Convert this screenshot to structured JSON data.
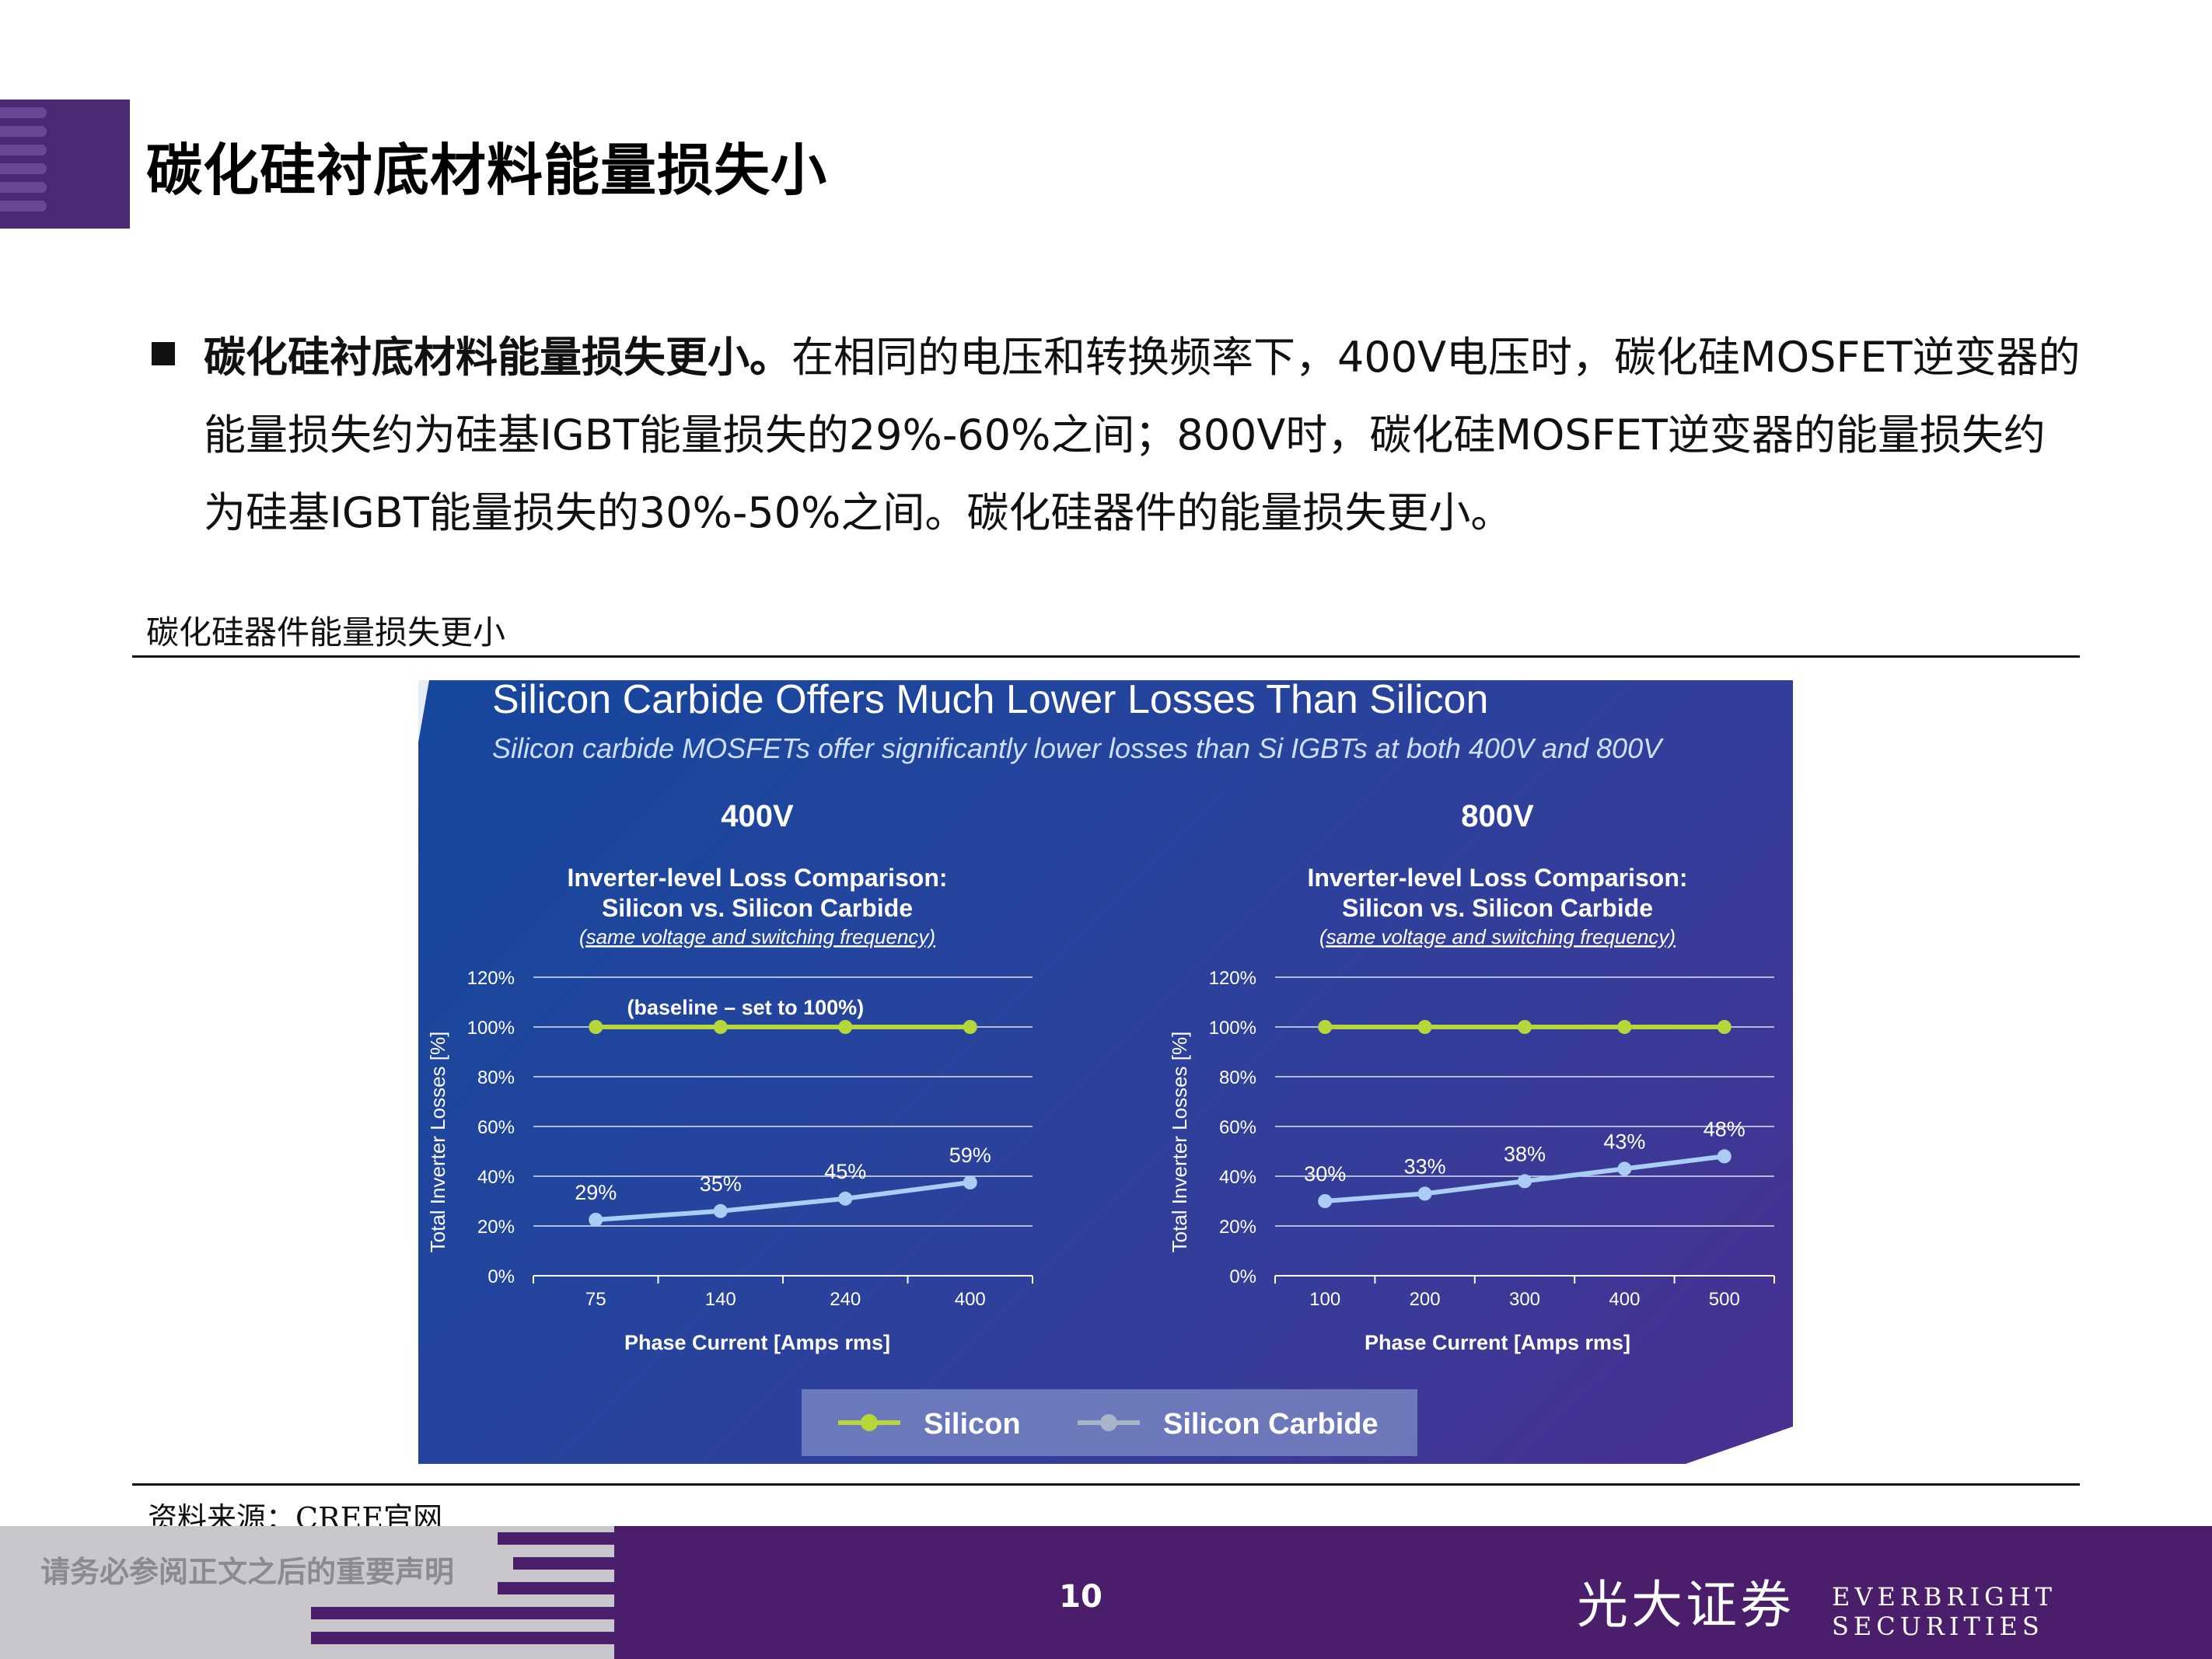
{
  "header": {
    "title": "碳化硅衬底材料能量损失小"
  },
  "bullet": {
    "bold": "碳化硅衬底材料能量损失更小。",
    "body": "在相同的电压和转换频率下，400V电压时，碳化硅MOSFET逆变器的能量损失约为硅基IGBT能量损失的29%-60%之间；800V时，碳化硅MOSFET逆变器的能量损失约为硅基IGBT能量损失的30%-50%之间。碳化硅器件的能量损失更小。"
  },
  "figure_caption": "碳化硅器件能量损失更小",
  "panel": {
    "title": "Silicon Carbide Offers Much Lower Losses Than Silicon",
    "subtitle": "Silicon carbide MOSFETs offer significantly lower losses than Si IGBTs at both 400V and 800V"
  },
  "legend": {
    "silicon": "Silicon",
    "sic": "Silicon Carbide"
  },
  "colors": {
    "silicon": "#b6d63a",
    "sic": "#a9cdf4"
  },
  "chart_data": [
    {
      "type": "line",
      "heading": "400V",
      "title": "Inverter-level Loss Comparison:",
      "title2": "Silicon vs. Silicon Carbide",
      "note": "(same voltage and switching frequency)",
      "annotation": "(baseline – set to 100%)",
      "categories": [
        "75",
        "140",
        "240",
        "400"
      ],
      "xlabel": "Phase Current [Amps rms]",
      "ylabel": "Total Inverter Losses [%]",
      "ylim": [
        0,
        120
      ],
      "yticks": [
        "0%",
        "20%",
        "40%",
        "60%",
        "80%",
        "100%",
        "120%"
      ],
      "grid": true,
      "series": [
        {
          "name": "Silicon",
          "values": [
            100,
            100,
            100,
            100
          ]
        },
        {
          "name": "Silicon Carbide",
          "values": [
            22.5,
            26,
            31,
            37.5
          ],
          "labels": [
            "29%",
            "35%",
            "45%",
            "59%"
          ]
        }
      ]
    },
    {
      "type": "line",
      "heading": "800V",
      "title": "Inverter-level Loss Comparison:",
      "title2": "Silicon vs. Silicon Carbide",
      "note": "(same voltage and switching frequency)",
      "categories": [
        "100",
        "200",
        "300",
        "400",
        "500"
      ],
      "xlabel": "Phase Current [Amps rms]",
      "ylabel": "Total Inverter Losses [%]",
      "ylim": [
        0,
        120
      ],
      "yticks": [
        "0%",
        "20%",
        "40%",
        "60%",
        "80%",
        "100%",
        "120%"
      ],
      "grid": true,
      "series": [
        {
          "name": "Silicon",
          "values": [
            100,
            100,
            100,
            100,
            100
          ]
        },
        {
          "name": "Silicon Carbide",
          "values": [
            30,
            33,
            38,
            43,
            48
          ],
          "labels": [
            "30%",
            "33%",
            "38%",
            "43%",
            "48%"
          ]
        }
      ]
    }
  ],
  "source_note": "资料来源：CREE官网",
  "footer": {
    "disclaimer": "请务必参阅正文之后的重要声明",
    "page_number": "10",
    "brand_cn": "光大证券",
    "brand_en": "EVERBRIGHT SECURITIES"
  }
}
